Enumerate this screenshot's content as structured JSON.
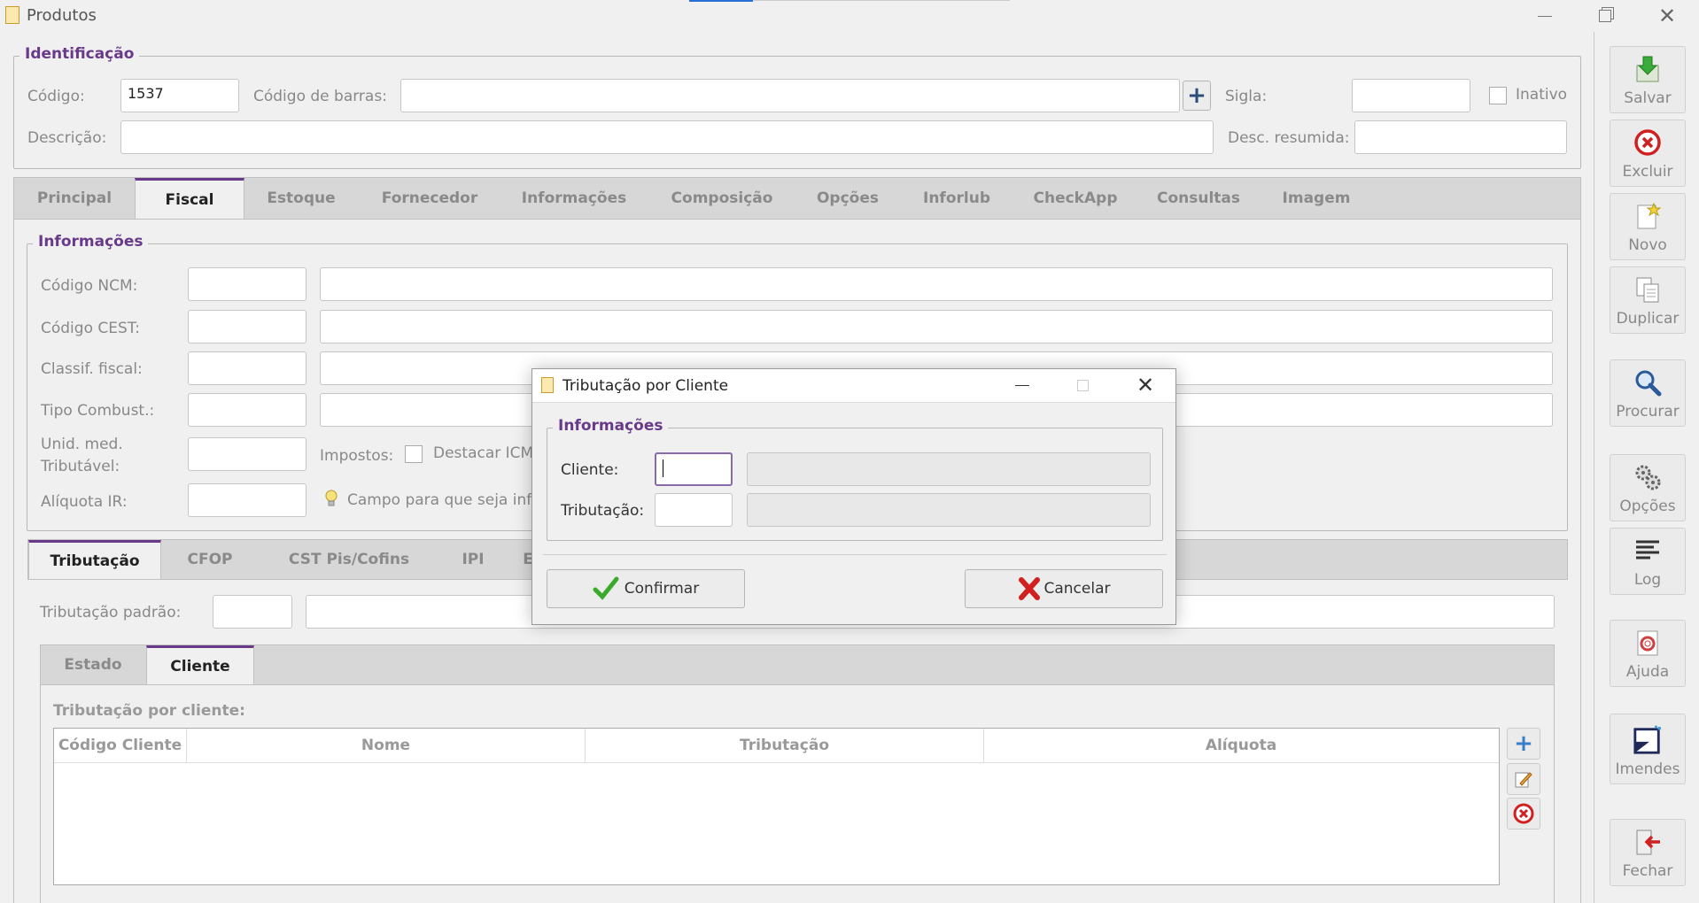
{
  "window": {
    "title": "Produtos"
  },
  "identificacao": {
    "legend": "Identificação",
    "codigo_label": "Código:",
    "codigo_value": "1537",
    "barras_label": "Código de barras:",
    "barras_value": "",
    "sigla_label": "Sigla:",
    "sigla_value": "",
    "inativo_label": "Inativo",
    "descricao_label": "Descrição:",
    "descricao_value": "",
    "desc_resumida_label": "Desc. resumida:",
    "desc_resumida_value": ""
  },
  "main_tabs": [
    "Principal",
    "Fiscal",
    "Estoque",
    "Fornecedor",
    "Informações",
    "Composição",
    "Opções",
    "Inforlub",
    "CheckApp",
    "Consultas",
    "Imagem"
  ],
  "informacoes": {
    "legend": "Informações",
    "ncm_label": "Código NCM:",
    "cest_label": "Código CEST:",
    "classif_label": "Classif. fiscal:",
    "combust_label": "Tipo Combust.:",
    "unid_label_1": "Unid. med.",
    "unid_label_2": "Tributável:",
    "impostos_label": "Impostos:",
    "destacar_label": "Destacar ICMS",
    "aliquota_label": "Alíquota IR:",
    "hint": "Campo para que seja infor"
  },
  "sub_tabs": [
    "Tributação",
    "CFOP",
    "CST Pis/Cofins",
    "IPI",
    "E"
  ],
  "trib_padrao_label": "Tributação padrão:",
  "inner_tabs": [
    "Estado",
    "Cliente"
  ],
  "grid": {
    "caption": "Tributação por cliente:",
    "columns": [
      "Código Cliente",
      "Nome",
      "Tributação",
      "Alíquota"
    ]
  },
  "sidebar": {
    "items": [
      "Salvar",
      "Excluir",
      "Novo",
      "Duplicar",
      "Procurar",
      "Opções",
      "Log",
      "Ajuda",
      "Imendes",
      "Fechar"
    ]
  },
  "dialog": {
    "title": "Tributação por Cliente",
    "legend": "Informações",
    "cliente_label": "Cliente:",
    "tributacao_label": "Tributação:",
    "confirm_label": "Confirmar",
    "cancel_label": "Cancelar"
  },
  "colors": {
    "accent": "#6a3a8a",
    "tab_bg": "#d7d7d7",
    "window_bg": "#f0f0f0"
  }
}
